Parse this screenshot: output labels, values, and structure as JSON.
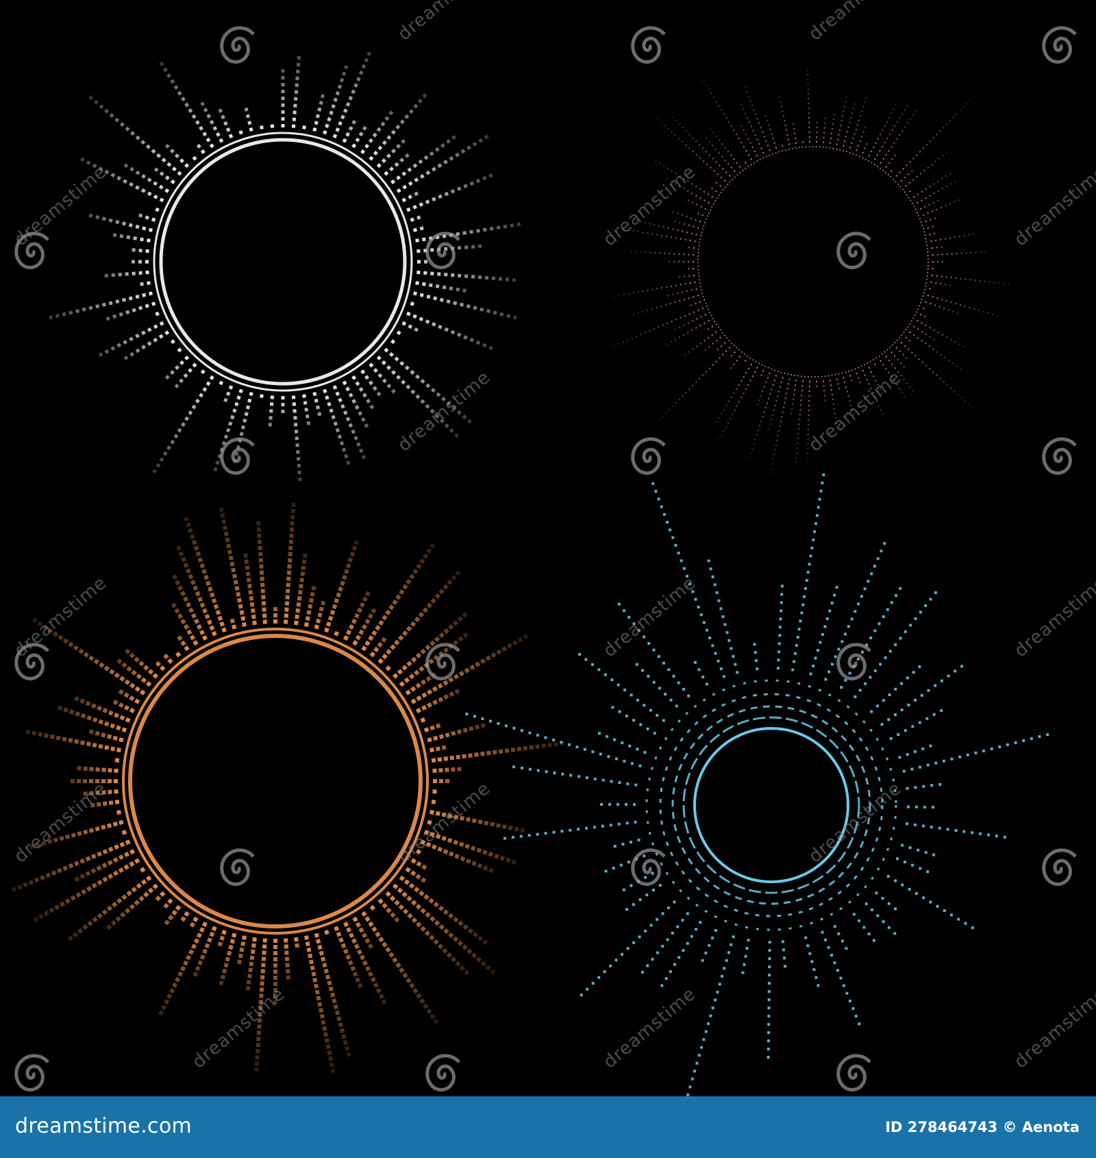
{
  "stock": {
    "brand": "dreamstime.com",
    "image_id": "ID 278464743",
    "author": "Aenota",
    "separator": "©",
    "watermark_text": "dreamstime"
  },
  "colors": {
    "background": "#000000",
    "footer": "#1a73a8",
    "circle_white": "#e8e8e8",
    "circle_pink": "#c47aa0",
    "circle_orange": "#d9884a",
    "circle_cyan": "#6cc8e6"
  },
  "artwork": {
    "items": [
      {
        "name": "white-dotted-equalizer-circle",
        "color": "circle_white",
        "style": "blocks"
      },
      {
        "name": "pink-dotted-equalizer-circle",
        "color": "circle_pink",
        "style": "fine"
      },
      {
        "name": "orange-dotted-equalizer-circle",
        "color": "circle_orange",
        "style": "dense"
      },
      {
        "name": "cyan-dotted-equalizer-circle",
        "color": "circle_cyan",
        "style": "rings"
      }
    ]
  }
}
